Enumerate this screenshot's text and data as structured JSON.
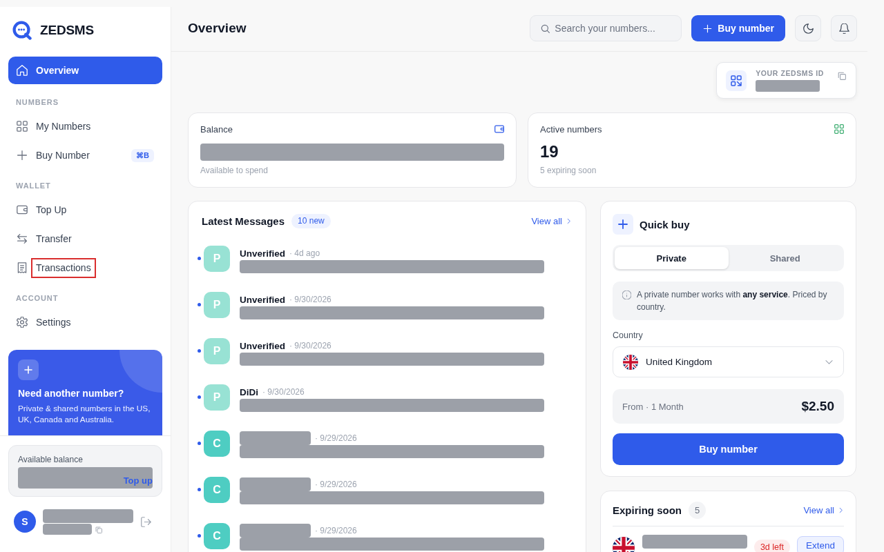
{
  "sidebar": {
    "brand": "ZEDSMS",
    "sections": [
      {
        "items": [
          {
            "label": "Overview",
            "selected": true,
            "highlighted": false
          }
        ]
      },
      {
        "title": "NUMBERS",
        "items": [
          {
            "label": "My Numbers",
            "selected": false,
            "highlighted": false
          },
          {
            "label": "Buy Number",
            "selected": false,
            "highlighted": false,
            "shortcut": "⌘B"
          }
        ]
      },
      {
        "title": "WALLET",
        "items": [
          {
            "label": "Top Up",
            "selected": false,
            "highlighted": false
          },
          {
            "label": "Transfer",
            "selected": false,
            "highlighted": false
          },
          {
            "label": "Transactions",
            "selected": false,
            "highlighted": true
          }
        ]
      },
      {
        "title": "ACCOUNT",
        "items": [
          {
            "label": "Settings",
            "selected": false,
            "highlighted": false
          }
        ]
      }
    ],
    "promo": {
      "title": "Need another number?",
      "text": "Private & shared numbers in the US, UK, Canada and Australia."
    },
    "balance": {
      "label": "Available balance",
      "link": "Top up"
    },
    "user": {
      "initial": "S"
    }
  },
  "topbar": {
    "title": "Overview",
    "search": {
      "placeholder": "Search your numbers..."
    },
    "button": "Buy number"
  },
  "id_card": {
    "label": "YOUR ZEDSMS ID"
  },
  "stats": [
    {
      "kind": "balance",
      "label": "Balance",
      "caption": "Available to spend"
    },
    {
      "kind": "count",
      "label": "Active numbers",
      "value": "19",
      "caption": "5 expiring soon"
    }
  ],
  "messages": {
    "title": "Latest Messages",
    "badge": "10 new",
    "link": "View all",
    "items": [
      {
        "avatar": "P",
        "color": "#98e2d4",
        "sender": "Unverified",
        "time": "· 4d ago",
        "unread": true
      },
      {
        "avatar": "P",
        "color": "#98e2d4",
        "sender": "Unverified",
        "time": "· 9/30/2026",
        "unread": true
      },
      {
        "avatar": "P",
        "color": "#98e2d4",
        "sender": "Unverified",
        "time": "· 9/30/2026",
        "unread": true
      },
      {
        "avatar": "P",
        "color": "#98e2d4",
        "sender": "DiDi",
        "time": "· 9/30/2026",
        "unread": true
      },
      {
        "avatar": "C",
        "color": "#4ecdc2",
        "time": "· 9/29/2026",
        "unread": true
      },
      {
        "avatar": "C",
        "color": "#4ecdc2",
        "time": "· 9/29/2026",
        "unread": true
      },
      {
        "avatar": "C",
        "color": "#4ecdc2",
        "time": "· 9/29/2026",
        "unread": true
      }
    ]
  },
  "quick_buy": {
    "title": "Quick buy",
    "tabs": [
      {
        "label": "Private",
        "selected": true
      },
      {
        "label": "Shared",
        "selected": false
      }
    ],
    "info": "A private number works with **any service**. Priced by country.",
    "country_label": "Country",
    "country": "United Kingdom",
    "price_label": "From · 1 Month",
    "price": "$2.50",
    "button": "Buy number"
  },
  "expiring": {
    "title": "Expiring soon",
    "count": "5",
    "link": "View all",
    "items": [
      {
        "days_left": "3d left",
        "action": "Extend"
      }
    ]
  }
}
